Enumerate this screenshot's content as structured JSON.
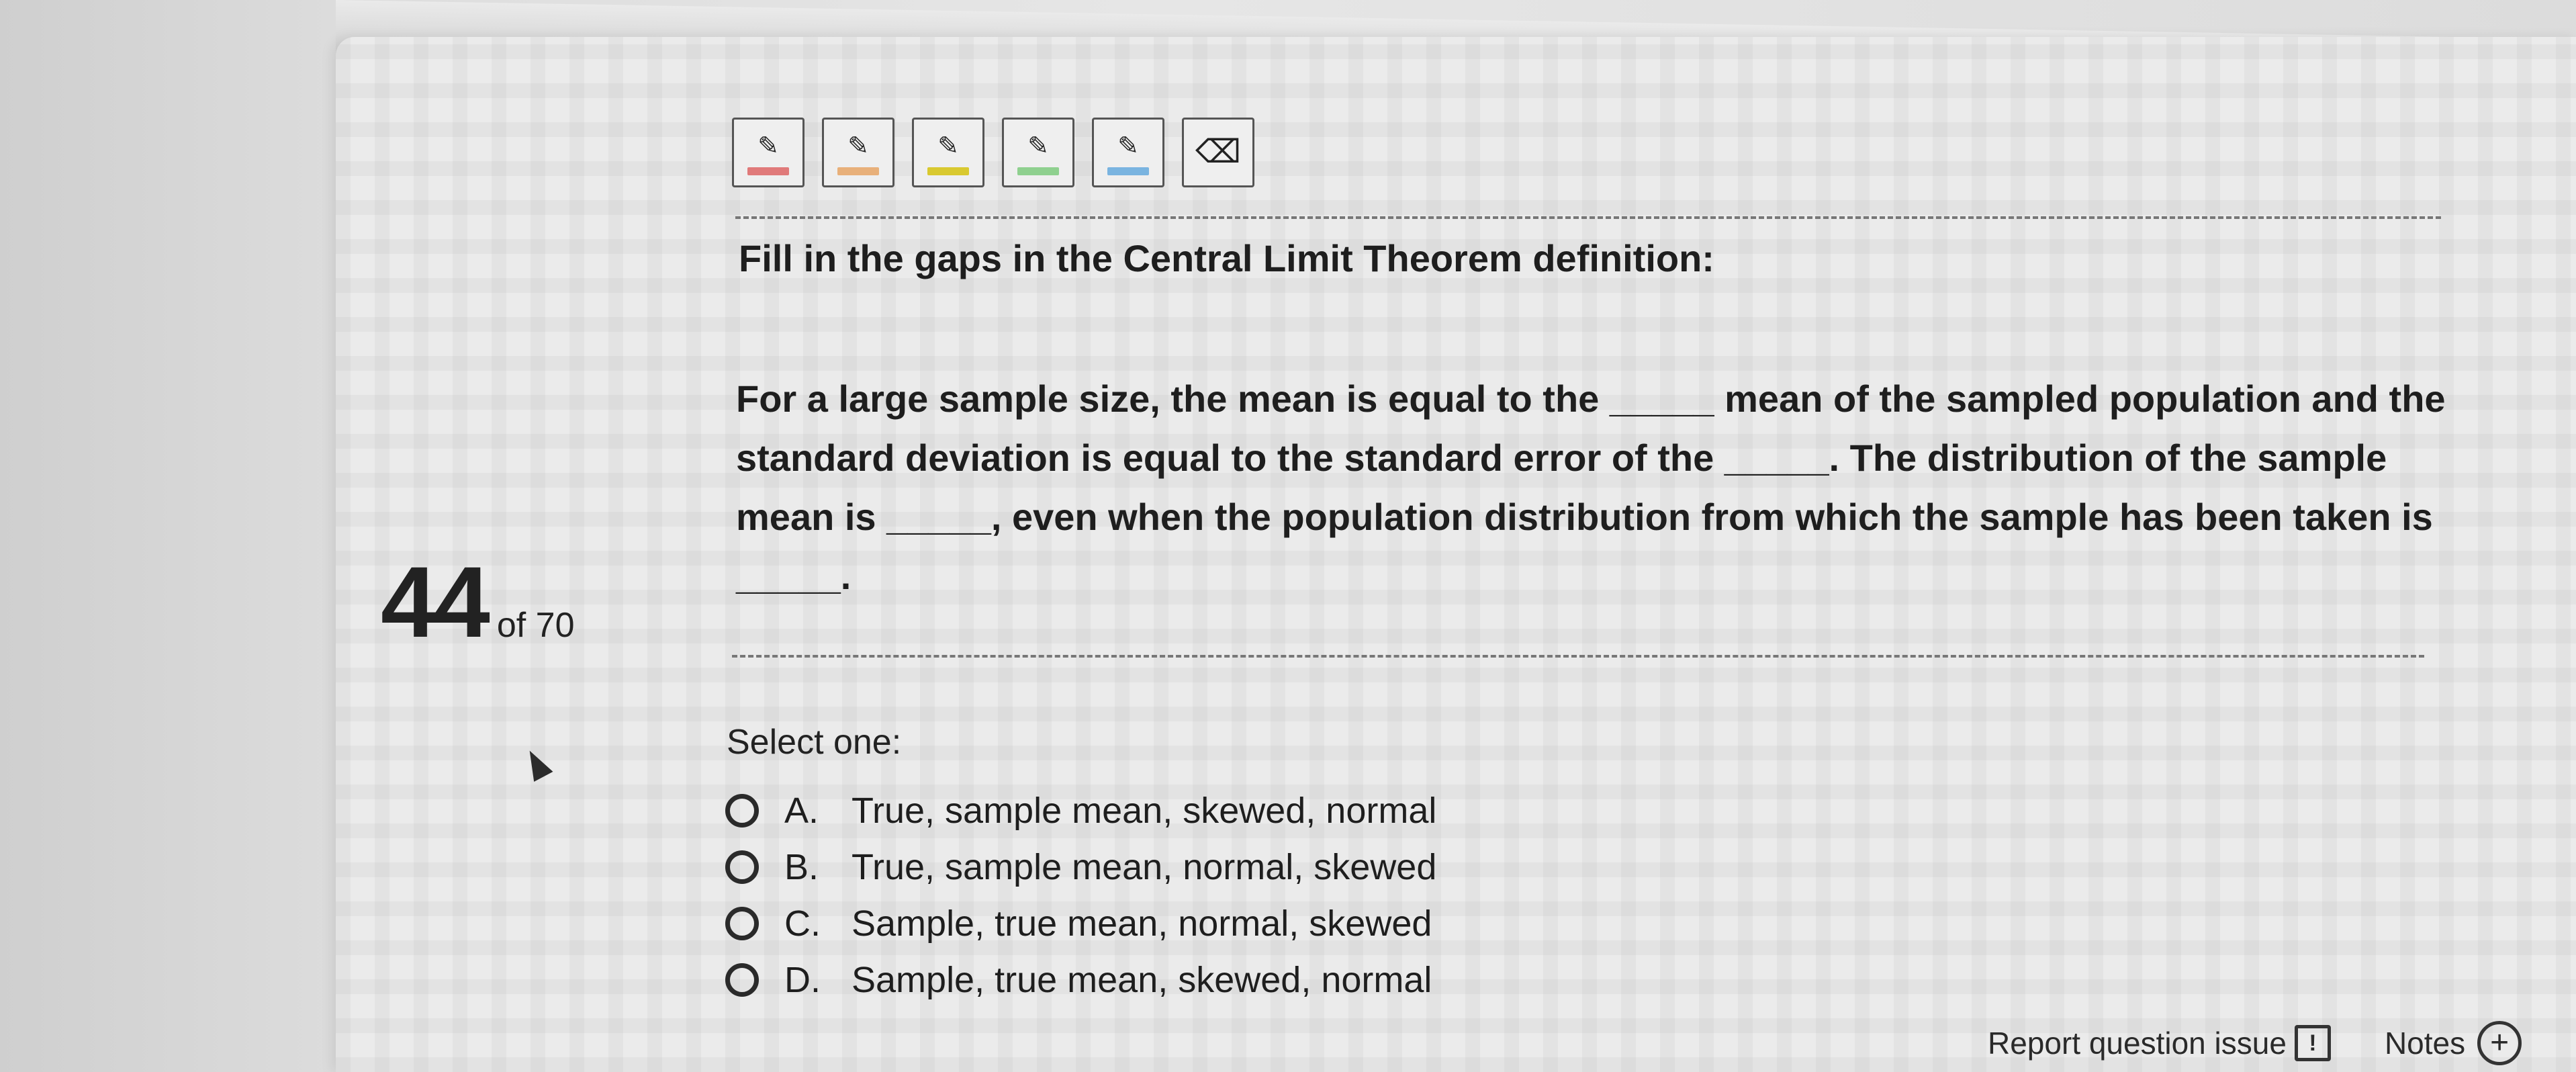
{
  "counter": {
    "current": "44",
    "total_label": "of 70"
  },
  "toolbar": {
    "tools": [
      {
        "name": "red-highlighter",
        "glyph": "✎",
        "color": "#e07a7a"
      },
      {
        "name": "orange-highlighter",
        "glyph": "✎",
        "color": "#e8b07a"
      },
      {
        "name": "yellow-highlighter",
        "glyph": "✎",
        "color": "#d9c930"
      },
      {
        "name": "green-highlighter",
        "glyph": "✎",
        "color": "#8fd08f"
      },
      {
        "name": "blue-highlighter",
        "glyph": "✎",
        "color": "#7ab4e0"
      },
      {
        "name": "eraser",
        "glyph": "⌫",
        "color": ""
      }
    ]
  },
  "question": {
    "prompt": "Fill in the gaps in the Central Limit Theorem definition:",
    "body": "For a large sample size, the mean is equal to the _____ mean of the sampled population and the standard deviation is equal to the standard error of the _____. The distribution of the sample mean is _____, even when the population distribution from which the sample has been taken is _____."
  },
  "answers": {
    "select_label": "Select one:",
    "options": [
      {
        "letter": "A.",
        "text": "True, sample mean, skewed, normal"
      },
      {
        "letter": "B.",
        "text": "True, sample mean, normal, skewed"
      },
      {
        "letter": "C.",
        "text": "Sample, true mean, normal, skewed"
      },
      {
        "letter": "D.",
        "text": "Sample, true mean, skewed, normal"
      }
    ]
  },
  "footer": {
    "report_label": "Report question issue",
    "report_icon": "!",
    "notes_label": "Notes",
    "notes_icon": "+"
  }
}
